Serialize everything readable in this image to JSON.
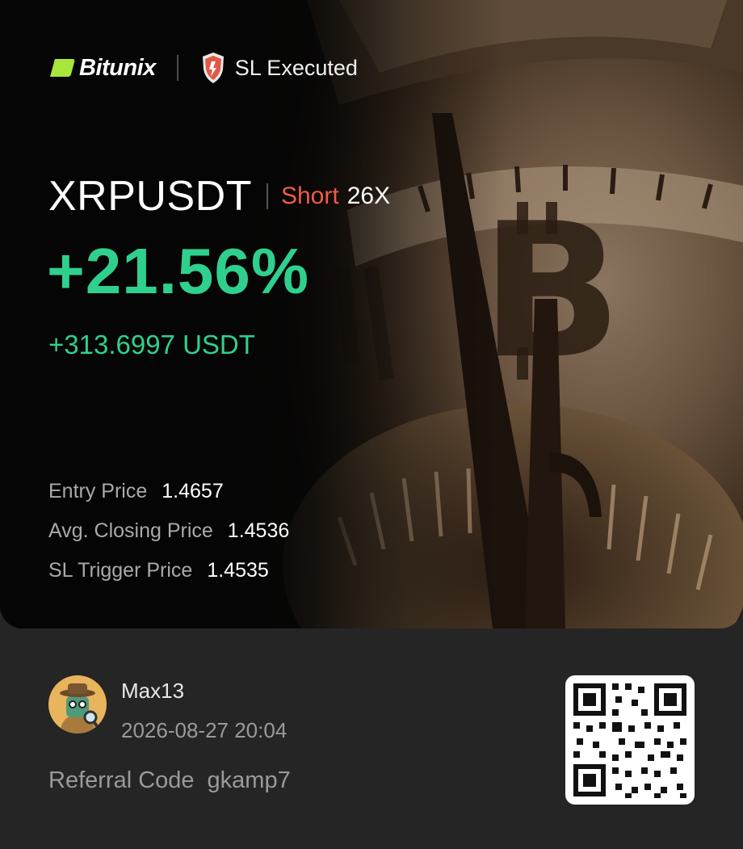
{
  "brand": {
    "name": "Bitunix",
    "accent": "#a8e63c"
  },
  "status": {
    "label": "SL Executed",
    "icon": "shield-icon"
  },
  "trade": {
    "pair": "XRPUSDT",
    "side": "Short",
    "leverage": "26X",
    "pnl_percent": "+21.56%",
    "pnl_amount": "+313.6997 USDT"
  },
  "details": [
    {
      "label": "Entry Price",
      "value": "1.4657"
    },
    {
      "label": "Avg. Closing Price",
      "value": "1.4536"
    },
    {
      "label": "SL Trigger Price",
      "value": "1.4535"
    }
  ],
  "user": {
    "name": "Max13",
    "timestamp": "2026-08-27 20:04",
    "avatar": "detective-avatar"
  },
  "referral": {
    "label": "Referral Code",
    "code": "gkamp7"
  },
  "colors": {
    "profit": "#2fd08d",
    "short": "#f05a4a",
    "background": "#252526",
    "card": "#050505"
  }
}
